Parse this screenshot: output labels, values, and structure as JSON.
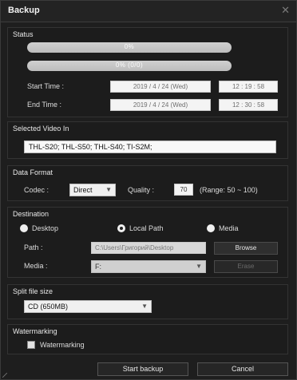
{
  "window": {
    "title": "Backup",
    "close_glyph": "✕"
  },
  "status": {
    "label": "Status",
    "bar1_text": "0%",
    "bar2_text": "0% (0/0)",
    "start_label": "Start Time :",
    "start_date": "2019  /  4  /  24  (Wed)",
    "start_time": "12 :  19 :  58",
    "end_label": "End Time :",
    "end_date": "2019  /  4  /  24  (Wed)",
    "end_time": "12 :  30 :  58"
  },
  "video": {
    "label": "Selected Video In",
    "value": "THL-S20; THL-S50; THL-S40; TI-S2M;"
  },
  "format": {
    "label": "Data Format",
    "codec_label": "Codec :",
    "codec_value": "Direct",
    "quality_label": "Quality :",
    "quality_value": "70",
    "range_text": "(Range: 50 ~ 100)"
  },
  "destination": {
    "label": "Destination",
    "radio_desktop": "Desktop",
    "radio_local": "Local Path",
    "radio_media": "Media",
    "selected": "Local Path",
    "path_label": "Path :",
    "path_value": "C:\\Users\\Григорий\\Desktop",
    "browse_label": "Browse",
    "media_label": "Media :",
    "media_value": "F:",
    "erase_label": "Erase"
  },
  "split": {
    "label": "Split file size",
    "value": "CD (650MB)"
  },
  "watermark": {
    "label": "Watermarking",
    "checkbox_label": "Watermarking",
    "checked": false
  },
  "actions": {
    "start_label": "Start backup",
    "cancel_label": "Cancel"
  }
}
